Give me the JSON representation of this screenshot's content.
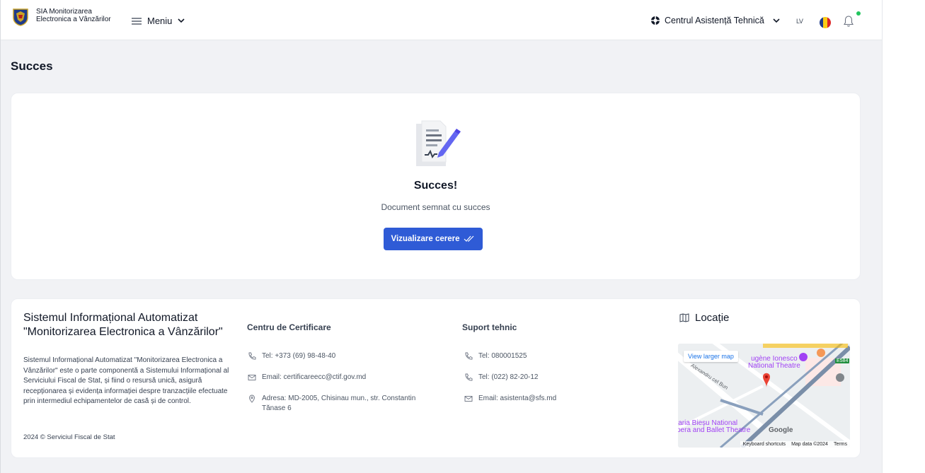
{
  "header": {
    "app_title_line1": "SIA Monitorizarea",
    "app_title_line2": "Electronica a Vânzărilor",
    "menu_label": "Meniu",
    "help_center_label": "Centrul Asistență Tehnică",
    "lang_label": "LV"
  },
  "page": {
    "title": "Succes"
  },
  "success": {
    "title": "Succes!",
    "message": "Document semnat cu succes",
    "button_label": "Vizualizare cerere"
  },
  "footer": {
    "system_title": "Sistemul Informațional Automatizat \"Monitorizarea Electronica a Vânzărilor\"",
    "description": "Sistemul Informațional Automatizat \"Monitorizarea Electronica a Vânzărilor\" este o parte componentă a Sistemului Informațional al Serviciului Fiscal de Stat, și fiind o resursă unică, asigură recepționarea și evidența informației despre tranzacțiile efectuate prin intermediul echipamentelor de casă și de control.",
    "copyright": "2024 © Serviciul Fiscal de Stat",
    "certification": {
      "heading": "Centru de Certificare",
      "phone": "Tel: +373 (69) 98-48-40",
      "email": "Email: certificareecc@ctif.gov.md",
      "address": "Adresa: MD-2005, Chisinau mun., str. Constantin Tănase 6"
    },
    "support": {
      "heading": "Suport tehnic",
      "phone1": "Tel: 080001525",
      "phone2": "Tel: (022) 82-20-12",
      "email": "Email: asistenta@sfs.md"
    },
    "location": {
      "heading": "Locație",
      "map": {
        "view_larger": "View larger map",
        "place1_line1": "ugène Ionesco",
        "place1_line2": "National Theatre",
        "place2_line1": "laria Bieșu National",
        "place2_line2": "pera and Ballet Theatre",
        "street": "Alexandru cel Bun",
        "road_number": "E584",
        "google": "Google",
        "shortcuts": "Keyboard shortcuts",
        "map_data": "Map data ©2024",
        "terms": "Terms"
      }
    }
  },
  "colors": {
    "primary": "#2f5bd6",
    "background": "#f1f2f5",
    "notification_dot": "#22c55e"
  },
  "icons": [
    "menu-icon",
    "chevron-down-icon",
    "lifebuoy-icon",
    "flag-icon",
    "bell-icon",
    "document-sign-icon",
    "double-check-icon",
    "phone-icon",
    "mail-icon",
    "location-pin-icon",
    "map-icon"
  ]
}
